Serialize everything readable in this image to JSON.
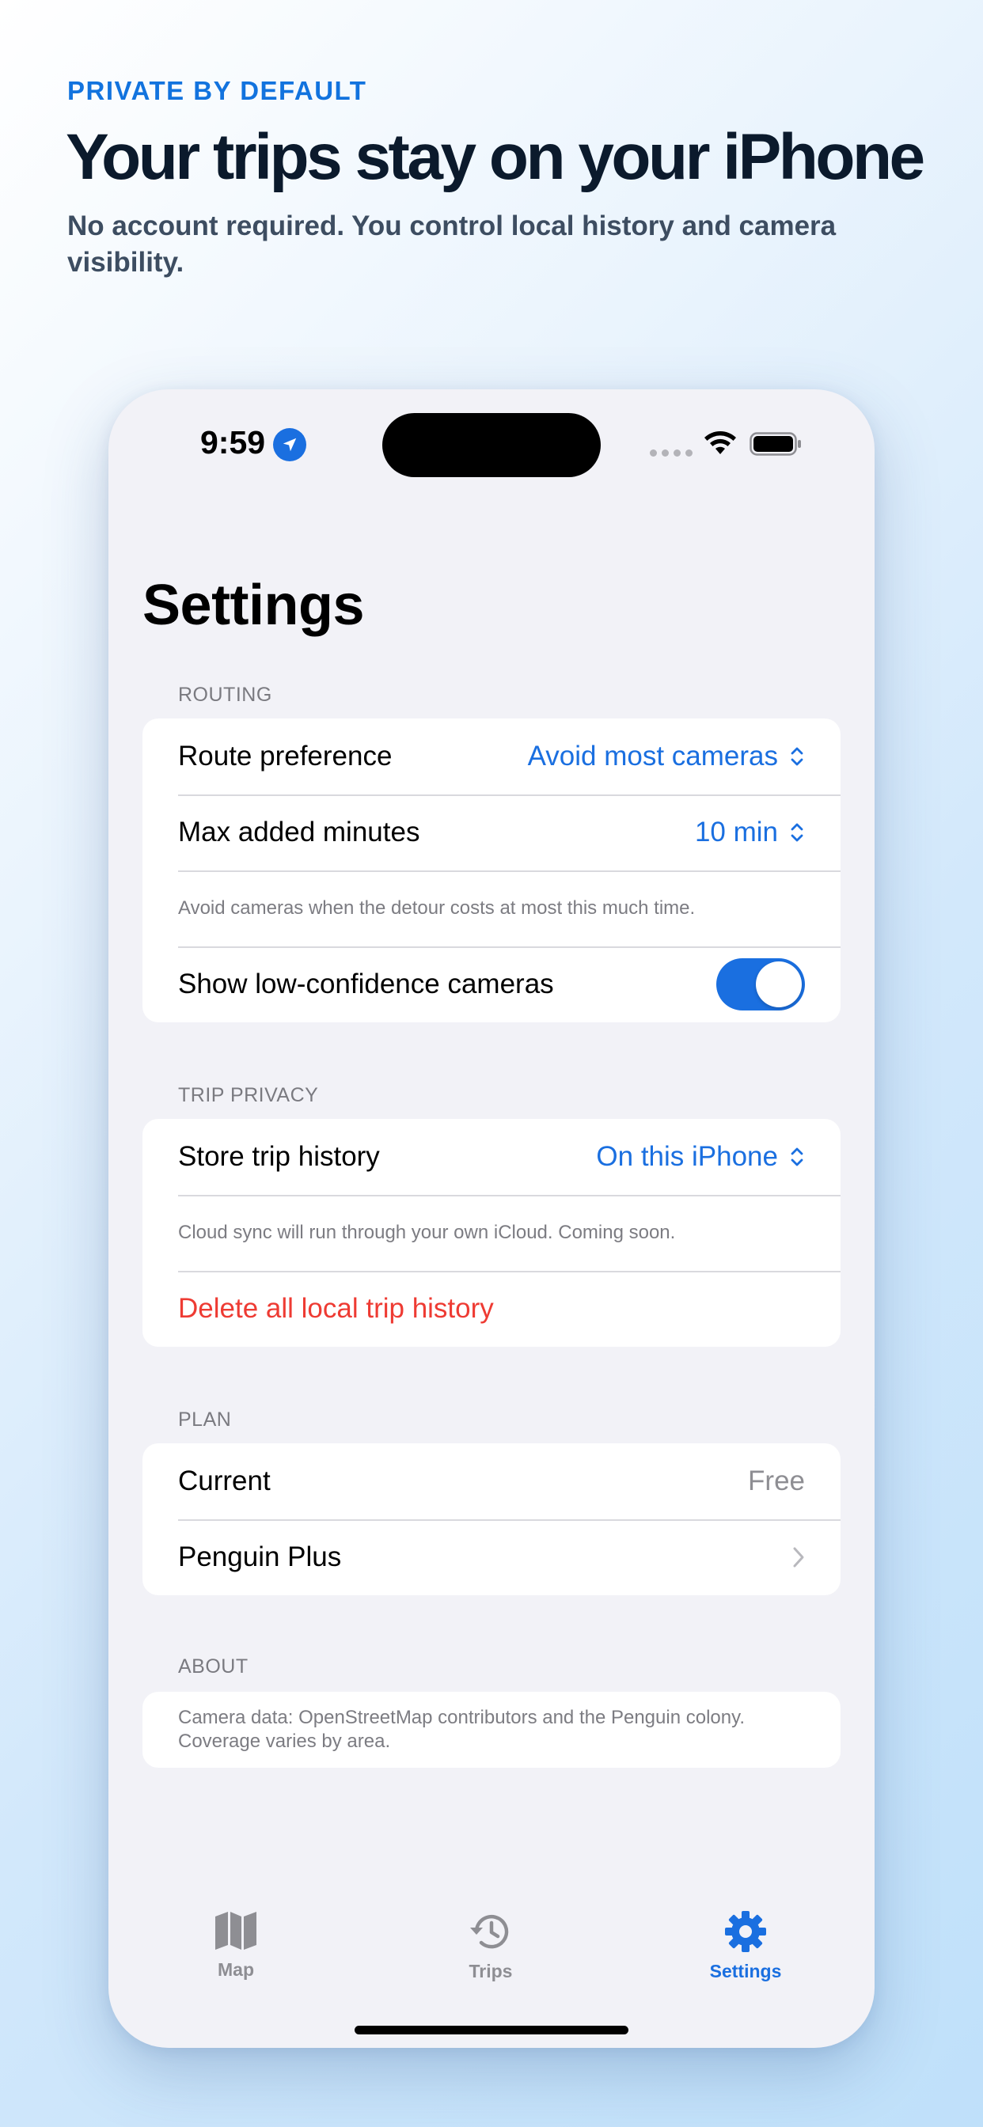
{
  "hero": {
    "eyebrow": "PRIVATE BY DEFAULT",
    "title": "Your trips stay on your iPhone",
    "subtitle": "No account required. You control local history and camera visibility."
  },
  "status_bar": {
    "time": "9:59"
  },
  "page": {
    "title": "Settings"
  },
  "routing": {
    "header": "ROUTING",
    "route_preference": {
      "label": "Route preference",
      "value": "Avoid most cameras"
    },
    "max_added_minutes": {
      "label": "Max added minutes",
      "value": "10 min"
    },
    "note": "Avoid cameras when the detour costs at most this much time.",
    "low_confidence": {
      "label": "Show low-confidence cameras",
      "enabled": true
    }
  },
  "trip_privacy": {
    "header": "TRIP PRIVACY",
    "store_history": {
      "label": "Store trip history",
      "value": "On this iPhone"
    },
    "note": "Cloud sync will run through your own iCloud. Coming soon.",
    "delete_label": "Delete all local trip history"
  },
  "plan": {
    "header": "PLAN",
    "current": {
      "label": "Current",
      "value": "Free"
    },
    "plus": {
      "label": "Penguin Plus"
    }
  },
  "about": {
    "header": "ABOUT",
    "text": "Camera data: OpenStreetMap contributors and the Penguin colony. Coverage varies by area."
  },
  "tabs": [
    {
      "label": "Map",
      "icon": "map-icon",
      "active": false
    },
    {
      "label": "Trips",
      "icon": "history-icon",
      "active": false
    },
    {
      "label": "Settings",
      "icon": "gear-icon",
      "active": true
    }
  ],
  "colors": {
    "accent": "#1a6fe0",
    "destructive": "#ee3b33",
    "eyebrow": "#1273de"
  }
}
